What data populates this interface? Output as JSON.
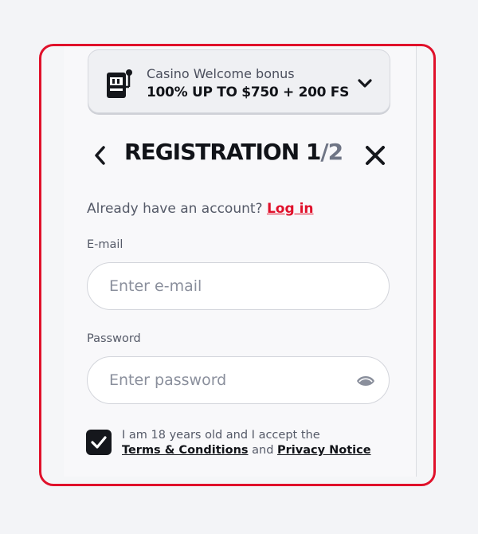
{
  "bonus": {
    "title": "Casino Welcome bonus",
    "offer": "100% UP TO $750 + 200 FS"
  },
  "header": {
    "title_main": "REGISTRATION 1",
    "title_sub": "/2"
  },
  "login_prompt": {
    "text": "Already have an account? ",
    "link": "Log in"
  },
  "form": {
    "email_label": "E-mail",
    "email_placeholder": "Enter e-mail",
    "password_label": "Password",
    "password_placeholder": "Enter password"
  },
  "consent": {
    "checked": true,
    "line1": "I am 18 years old and I accept the",
    "terms_link": "Terms & Conditions",
    "and": " and ",
    "privacy_link": "Privacy Notice"
  },
  "colors": {
    "accent": "#e0112b",
    "text_dark": "#111318",
    "checkbox": "#15171c"
  }
}
